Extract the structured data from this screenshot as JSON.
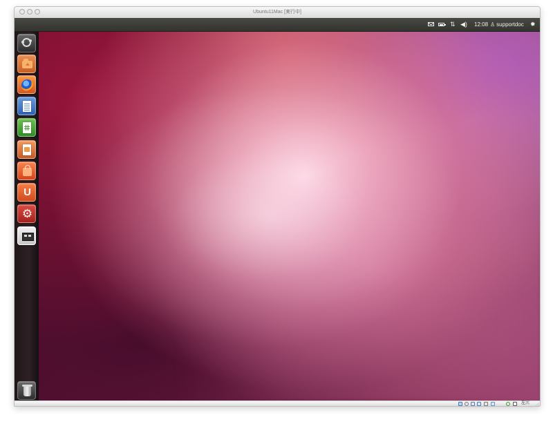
{
  "window": {
    "title": "Ubuntu11Mac [実行中]"
  },
  "top_panel": {
    "time": "12:08",
    "username": "supportdoc",
    "icons": [
      "mail-icon",
      "battery-icon",
      "network-icon",
      "volume-icon",
      "user-icon",
      "gear-icon"
    ]
  },
  "launcher": {
    "items": [
      {
        "name": "dash-home",
        "icon": "ubuntu-logo-icon"
      },
      {
        "name": "home-folder",
        "icon": "home-folder-icon"
      },
      {
        "name": "firefox",
        "icon": "firefox-icon"
      },
      {
        "name": "libreoffice-writer",
        "icon": "writer-document-icon"
      },
      {
        "name": "libreoffice-calc",
        "icon": "calc-spreadsheet-icon"
      },
      {
        "name": "libreoffice-impress",
        "icon": "impress-presentation-icon"
      },
      {
        "name": "ubuntu-software-center",
        "icon": "software-bag-icon"
      },
      {
        "name": "ubuntu-one",
        "icon": "ubuntu-one-icon"
      },
      {
        "name": "system-settings",
        "icon": "settings-tools-icon"
      },
      {
        "name": "workspace-switcher",
        "icon": "workspace-switcher-icon"
      },
      {
        "name": "trash",
        "icon": "trash-icon"
      }
    ],
    "ubuntu_one_label": "U",
    "settings_glyph": "⚙"
  },
  "desktop": {
    "background": "blurred pink and purple gradient",
    "colors": {
      "dark_plum": "#4b0d30",
      "raspberry": "#a52b55",
      "pink_light": "#f7c6d6",
      "orange_glow": "#e46d55",
      "purple_glow": "#a95db7"
    }
  },
  "status_bar": {
    "host_key_text": "左⌘",
    "icons": [
      "storage-icon",
      "optical-drive-icon",
      "usb-icon",
      "network-adapter-icon",
      "shared-folder-icon",
      "display-icon",
      "capture-icon",
      "mouse-integration-icon"
    ]
  }
}
